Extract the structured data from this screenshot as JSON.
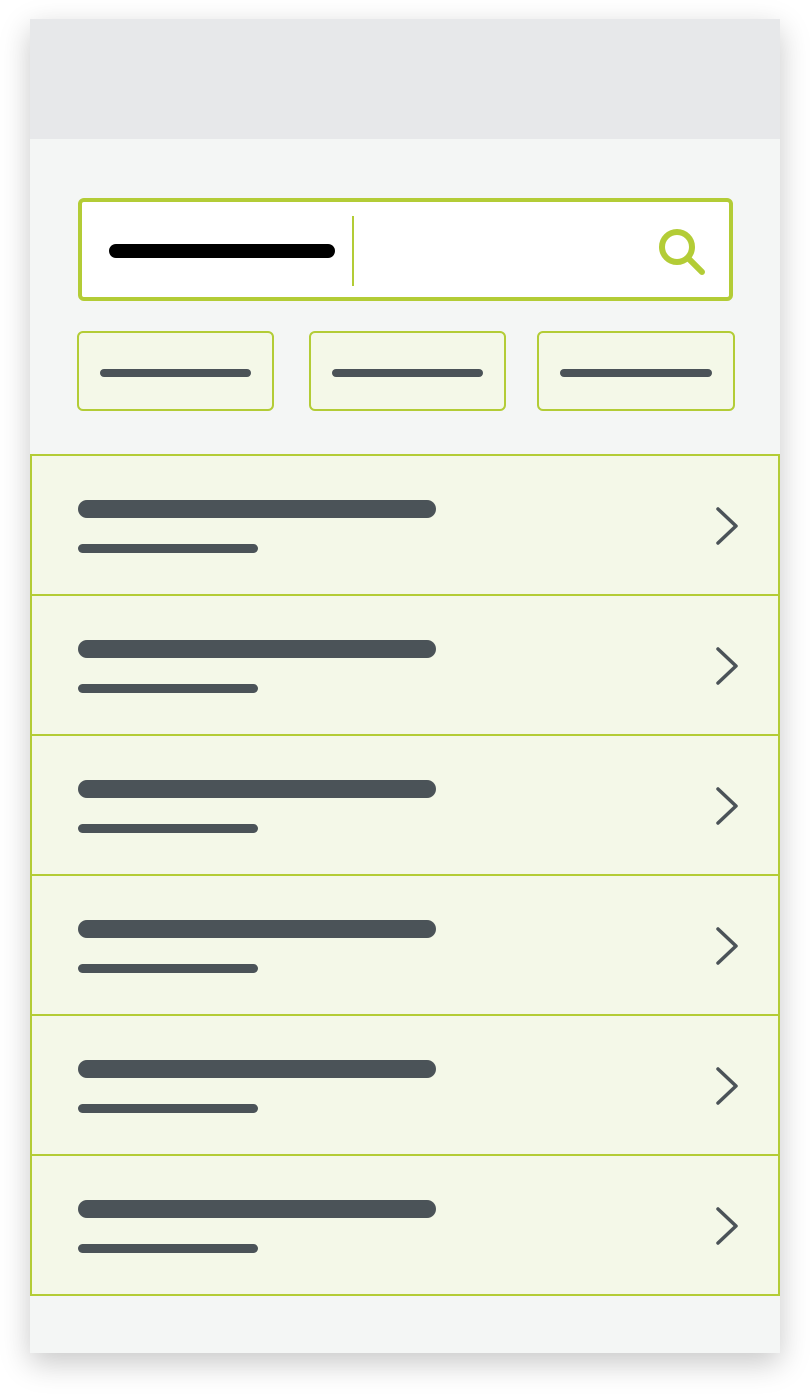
{
  "colors": {
    "accent": "#b3cc36",
    "text_placeholder": "#4b5358",
    "item_background": "#f4f8e8",
    "page_background": "#f4f6f5",
    "top_bar": "#e7e8ea",
    "input_text": "#000000"
  },
  "search": {
    "icon": "search-icon"
  },
  "filters": [
    {
      "icon": "none"
    },
    {
      "icon": "none"
    },
    {
      "icon": "none"
    }
  ],
  "list": {
    "item_count": 6,
    "items": [
      {
        "trailing_icon": "chevron-right-icon"
      },
      {
        "trailing_icon": "chevron-right-icon"
      },
      {
        "trailing_icon": "chevron-right-icon"
      },
      {
        "trailing_icon": "chevron-right-icon"
      },
      {
        "trailing_icon": "chevron-right-icon"
      },
      {
        "trailing_icon": "chevron-right-icon"
      }
    ]
  }
}
